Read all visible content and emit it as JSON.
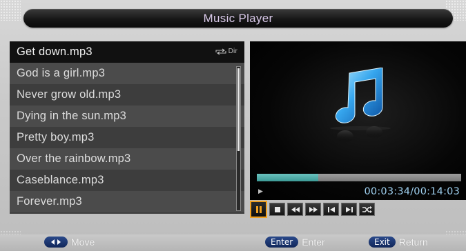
{
  "header": {
    "title": "Music Player"
  },
  "playlist": {
    "mode_label": "Dir",
    "items": [
      {
        "label": "Get down.mp3"
      },
      {
        "label": "God is a girl.mp3"
      },
      {
        "label": "Never grow old.mp3"
      },
      {
        "label": "Dying in the sun.mp3"
      },
      {
        "label": "Pretty boy.mp3"
      },
      {
        "label": "Over the rainbow.mp3"
      },
      {
        "label": "Caseblance.mp3"
      },
      {
        "label": "Forever.mp3"
      }
    ],
    "selected_index": 0
  },
  "player": {
    "time": "00:03:34/00:14:03",
    "progress_fraction": 0.3,
    "artwork_icon": "music-note-icon",
    "controls": [
      {
        "icon": "pause-icon",
        "active": true
      },
      {
        "icon": "stop-icon",
        "active": false
      },
      {
        "icon": "rewind-icon",
        "active": false
      },
      {
        "icon": "fast-forward-icon",
        "active": false
      },
      {
        "icon": "previous-track-icon",
        "active": false
      },
      {
        "icon": "next-track-icon",
        "active": false
      },
      {
        "icon": "shuffle-icon",
        "active": false
      }
    ]
  },
  "footer": {
    "move_label": "Move",
    "enter_key": "Enter",
    "enter_label": "Enter",
    "exit_key": "Exit",
    "exit_label": "Return"
  },
  "colors": {
    "accent_teal": "#3d9a96",
    "time_text": "#9fd0f0",
    "active_control_border": "#f0a020",
    "key_pill": "#1d3a78"
  }
}
